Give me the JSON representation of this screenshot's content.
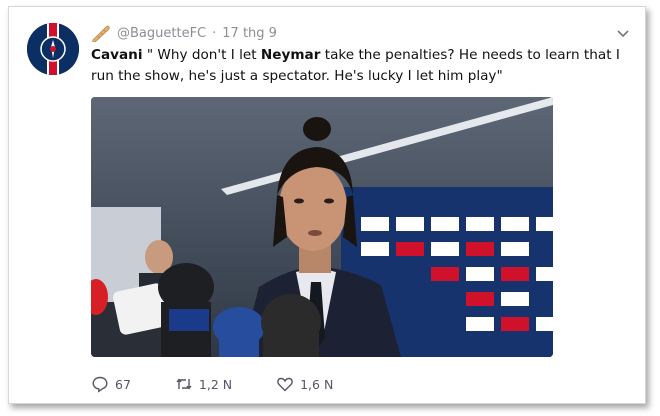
{
  "tweet": {
    "handle": "@BaguetteFC",
    "separator": "·",
    "date": "17 thg 9",
    "text_parts": [
      {
        "text": "Cavani",
        "bold": true
      },
      {
        "text": " \" Why don't I let ",
        "bold": false
      },
      {
        "text": "Neymar",
        "bold": true
      },
      {
        "text": " take the penalties? He needs to learn that I run the show, he's just a spectator. He's lucky I let him play\"",
        "bold": false
      }
    ],
    "actions": {
      "replies": "67",
      "retweets": "1,2 N",
      "likes": "1,6 N"
    }
  },
  "icons": {
    "avatar": "psg-crest-avatar",
    "header_emoji": "baguette-icon",
    "menu": "chevron-down-icon",
    "reply": "reply-icon",
    "retweet": "retweet-icon",
    "like": "heart-icon"
  },
  "colors": {
    "text": "#111111",
    "muted": "#8a8f95",
    "psg_blue": "#0b2e63",
    "psg_red": "#d0112b"
  }
}
